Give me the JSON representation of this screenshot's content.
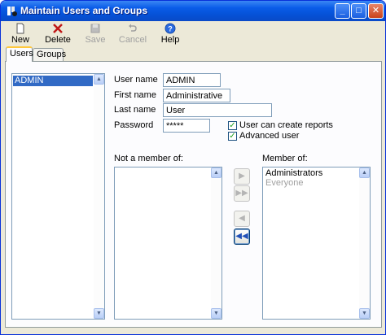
{
  "window": {
    "title": "Maintain Users and Groups",
    "controls": {
      "minimize": "_",
      "maximize": "□",
      "close": "✕"
    }
  },
  "toolbar": {
    "new": {
      "label": "New",
      "icon": "new-document-icon",
      "enabled": true
    },
    "delete": {
      "label": "Delete",
      "icon": "delete-x-icon",
      "enabled": true
    },
    "save": {
      "label": "Save",
      "icon": "save-disk-icon",
      "enabled": false
    },
    "cancel": {
      "label": "Cancel",
      "icon": "undo-icon",
      "enabled": false
    },
    "help": {
      "label": "Help",
      "icon": "help-icon",
      "enabled": true
    }
  },
  "tabs": [
    {
      "label": "Users",
      "active": true
    },
    {
      "label": "Groups",
      "active": false
    }
  ],
  "users_list": {
    "items": [
      {
        "label": "ADMIN",
        "selected": true
      }
    ]
  },
  "form": {
    "user_name": {
      "label": "User name",
      "value": "ADMIN"
    },
    "first_name": {
      "label": "First name",
      "value": "Administrative"
    },
    "last_name": {
      "label": "Last name",
      "value": "User"
    },
    "password": {
      "label": "Password",
      "value": "*****"
    },
    "can_create_reports": {
      "label": "User can create reports",
      "checked": true
    },
    "advanced_user": {
      "label": "Advanced user",
      "checked": true
    }
  },
  "not_member": {
    "label": "Not a member of:",
    "items": []
  },
  "member": {
    "label": "Member of:",
    "items": [
      {
        "label": "Administrators",
        "dim": false
      },
      {
        "label": "Everyone",
        "dim": true
      }
    ]
  },
  "move_buttons": {
    "add": "▶",
    "add_all": "▶▶",
    "remove": "◀",
    "remove_all": "◀◀"
  },
  "colors": {
    "titlebar": "#0a5ce8",
    "selection": "#316ac5",
    "check": "#21a121",
    "tab_highlight": "#ffc83c"
  }
}
